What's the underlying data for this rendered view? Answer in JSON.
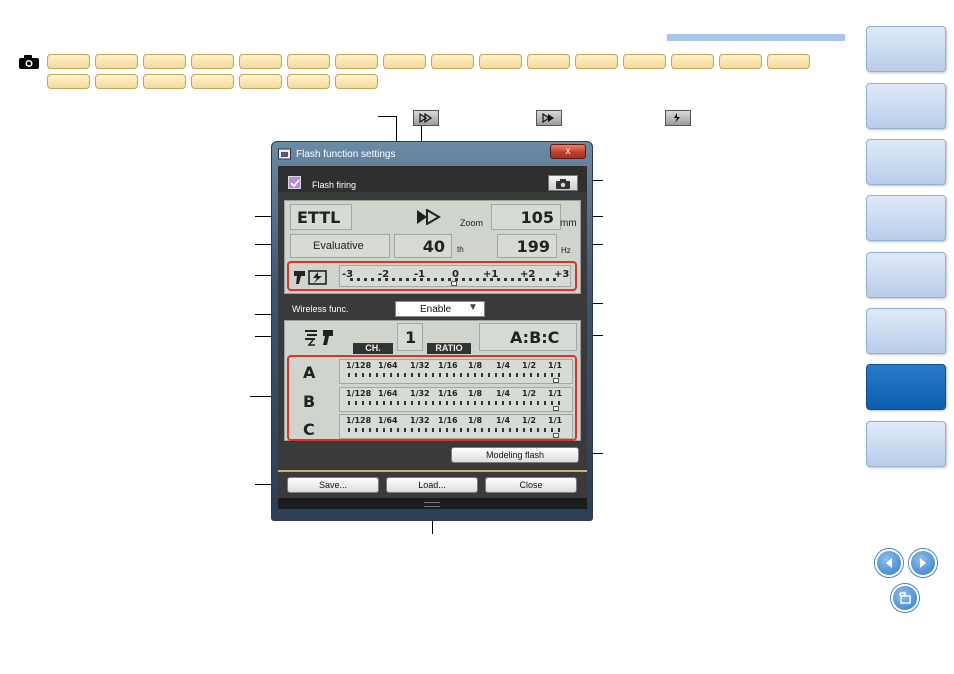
{
  "window": {
    "title": "Flash function settings",
    "close_label": "x"
  },
  "flash_firing": {
    "label": "Flash firing",
    "checked": true
  },
  "meter": {
    "mode": "ETTL",
    "zoom_label": "Zoom",
    "zoom_value": "105",
    "zoom_unit": "mm",
    "metering": "Evaluative",
    "fec_value": "40",
    "fec_unit": "th",
    "freq_value": "199",
    "freq_unit": "Hz",
    "scale": [
      "-3",
      "-2",
      "-1",
      "0",
      "+1",
      "+2",
      "+3"
    ]
  },
  "wireless": {
    "label": "Wireless func.",
    "value": "Enable",
    "ch_label": "CH.",
    "ch_value": "1",
    "ratio_label": "RATIO",
    "ratio_value": "A:B:C"
  },
  "groups": [
    {
      "name": "A"
    },
    {
      "name": "B"
    },
    {
      "name": "C"
    }
  ],
  "power_scale": [
    "1/128",
    "1/64",
    "1/32",
    "1/16",
    "1/8",
    "1/4",
    "1/2",
    "1/1"
  ],
  "buttons": {
    "modeling": "Modeling flash",
    "save": "Save...",
    "load": "Load...",
    "close": "Close"
  },
  "colors": {
    "accent_red": "#d9342a",
    "nav_active": "#0b5faf",
    "tab_fill": "#f4d99a"
  }
}
